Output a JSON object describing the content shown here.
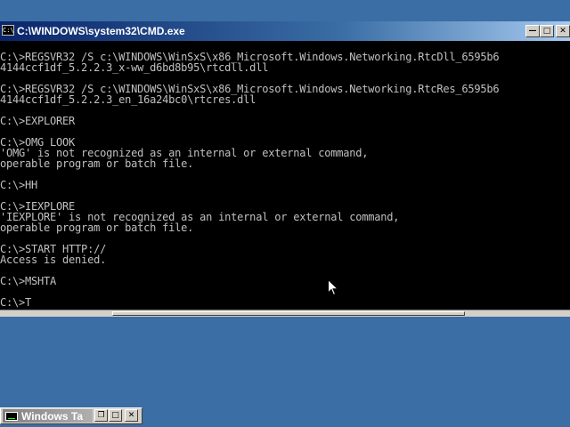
{
  "cmd_window": {
    "title": "C:\\WINDOWS\\system32\\CMD.exe",
    "icon_label": "C:\\",
    "icon": "cmd-icon",
    "buttons": {
      "minimize": "—",
      "maximize": "□",
      "close": "✕"
    },
    "console_lines": [
      "",
      "C:\\>REGSVR32 /S c:\\WINDOWS\\WinSxS\\x86_Microsoft.Windows.Networking.RtcDll_6595b6",
      "4144ccf1df_5.2.2.3_x-ww_d6bd8b95\\rtcdll.dll",
      "",
      "C:\\>REGSVR32 /S c:\\WINDOWS\\WinSxS\\x86_Microsoft.Windows.Networking.RtcRes_6595b6",
      "4144ccf1df_5.2.2.3_en_16a24bc0\\rtcres.dll",
      "",
      "C:\\>EXPLORER",
      "",
      "C:\\>OMG LOOK",
      "'OMG' is not recognized as an internal or external command,",
      "operable program or batch file.",
      "",
      "C:\\>HH",
      "",
      "C:\\>IEXPLORE",
      "'IEXPLORE' is not recognized as an internal or external command,",
      "operable program or batch file.",
      "",
      "C:\\>START HTTP://",
      "Access is denied.",
      "",
      "C:\\>MSHTA",
      "",
      "C:\\>T"
    ]
  },
  "minimized_window": {
    "title": "Windows Ta",
    "icon": "task-manager-icon",
    "buttons": {
      "restore": "❐",
      "maximize": "□",
      "close": "✕"
    }
  },
  "colors": {
    "desktop": "#3a6ea5",
    "title_active": "#0a246a",
    "console_bg": "#000000",
    "console_text": "#c0c0c0"
  }
}
